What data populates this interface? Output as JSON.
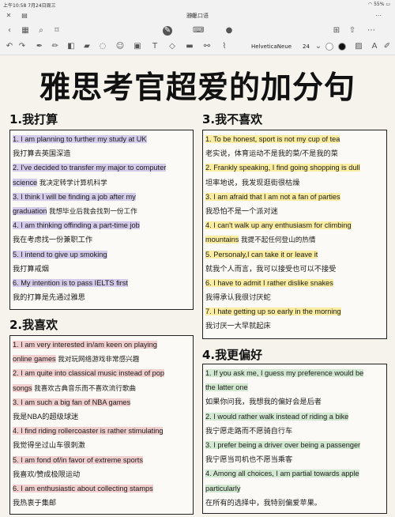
{
  "status": {
    "time": "上午10:58",
    "date": "7月24日周三",
    "battery": "55%"
  },
  "document": {
    "title": "雅思口语"
  },
  "toolbar": {
    "font_name": "HelveticaNeue",
    "font_size": "24"
  },
  "page": {
    "title": "雅思考官超爱的加分句",
    "sections": [
      {
        "heading": "1.我打算",
        "highlight": "purple",
        "lines": [
          {
            "text": "1. I am planning to further my study at UK",
            "hl": true
          },
          {
            "text": "我打算去英国深造",
            "hl": false
          },
          {
            "text": "2. I've decided to transfer my major to computer",
            "hl": true
          },
          {
            "text": "science",
            "zh": "我决定转学计算机科学",
            "hl": true
          },
          {
            "text": "3. I think I will be finding a job after my",
            "hl": true
          },
          {
            "text": "graduation",
            "zh": "我想毕业后我会找到一份工作",
            "hl": true
          },
          {
            "text": "4. I am thinking offinding a part-time job",
            "hl": true
          },
          {
            "text": "我在考虑找一份兼职工作",
            "hl": false
          },
          {
            "text": "5. I intend to give up smoking",
            "hl": true
          },
          {
            "text": "我打算戒烟",
            "hl": false
          },
          {
            "text": "6. My intention is to pass IELTS first",
            "hl": true
          },
          {
            "text": "我的打算是先通过雅思",
            "hl": false
          }
        ]
      },
      {
        "heading": "3.我不喜欢",
        "highlight": "yellow",
        "lines": [
          {
            "text": "1. To be honest, sport is not my cup of tea",
            "hl": true
          },
          {
            "text": "老实说，体育运动不是我的菜/不是我的菜",
            "hl": false
          },
          {
            "text": "2. Frankly speaking, I find going shopping is dull",
            "hl": true
          },
          {
            "text": "坦率地说，我发现逛街很枯燥",
            "hl": false
          },
          {
            "text": "3. I am afraid that I am not a fan of parties",
            "hl": true
          },
          {
            "text": "我恐怕不是一个派对迷",
            "hl": false
          },
          {
            "text": "4. I can't walk up any enthusiasm for climbing",
            "hl": true
          },
          {
            "text": "mountains",
            "zh": "我提不起任何登山的热情",
            "hl": true
          },
          {
            "text": "5. Personaly,I can take it or leave it",
            "hl": true
          },
          {
            "text": "就我个人而言，我可以接受也可以不接受",
            "hl": false
          },
          {
            "text": "6. I have to admit I rather dislike snakes",
            "hl": true
          },
          {
            "text": "我得承认我很讨厌蛇",
            "hl": false
          },
          {
            "text": "7. I hate getting up so early in the morning",
            "hl": true
          },
          {
            "text": "我讨厌一大早就起床",
            "hl": false
          }
        ]
      },
      {
        "heading": "2.我喜欢",
        "highlight": "pink",
        "lines": [
          {
            "text": "1. I am very interested in/am keen on playing",
            "hl": true
          },
          {
            "text": "online games",
            "zh": "我对玩网络游戏非常感兴趣",
            "hl": true
          },
          {
            "text": "2. I am quite into classical music instead of pop",
            "hl": true
          },
          {
            "text": "songs",
            "zh": "我喜欢古典音乐而不喜欢流行歌曲",
            "hl": true
          },
          {
            "text": "3. I am such a big fan of NBA games",
            "hl": true
          },
          {
            "text": "我是NBA的超级球迷",
            "hl": false
          },
          {
            "text": "4. I find riding rollercoaster is rather stimulating",
            "hl": true
          },
          {
            "text": "我觉得坐过山车很刺激",
            "hl": false
          },
          {
            "text": "5. I am fond of/in favor of extreme sports",
            "hl": true
          },
          {
            "text": "我喜欢/赞成极限运动",
            "hl": false
          },
          {
            "text": "6. I am enthusiastic about collecting stamps",
            "hl": true
          },
          {
            "text": "我热衷于集邮",
            "hl": false
          }
        ]
      },
      {
        "heading": "4.我更偏好",
        "highlight": "green",
        "lines": [
          {
            "text": "1. If you ask me, I guess my preference would be",
            "hl": true
          },
          {
            "text": "the latter one",
            "hl": true
          },
          {
            "text": "如果你问我，我想我的偏好会是后者",
            "hl": false
          },
          {
            "text": "2. I would rather walk instead of riding a bike",
            "hl": true
          },
          {
            "text": "我宁愿走路而不愿骑自行车",
            "hl": false
          },
          {
            "text": "3. I prefer being a driver over being a passenger",
            "hl": true
          },
          {
            "text": "我宁愿当司机也不愿当乘客",
            "hl": false
          },
          {
            "text": "4. Among all choices, I am partial towards apple",
            "hl": true
          },
          {
            "text": "particularly",
            "hl": true
          },
          {
            "text": "在所有的选择中，我特别偏爱苹果。",
            "hl": false
          }
        ]
      }
    ]
  },
  "colors": {
    "purple": "#c7bae6",
    "yellow": "#fae98c",
    "pink": "#eec4c4",
    "green": "#c4e2c4"
  }
}
